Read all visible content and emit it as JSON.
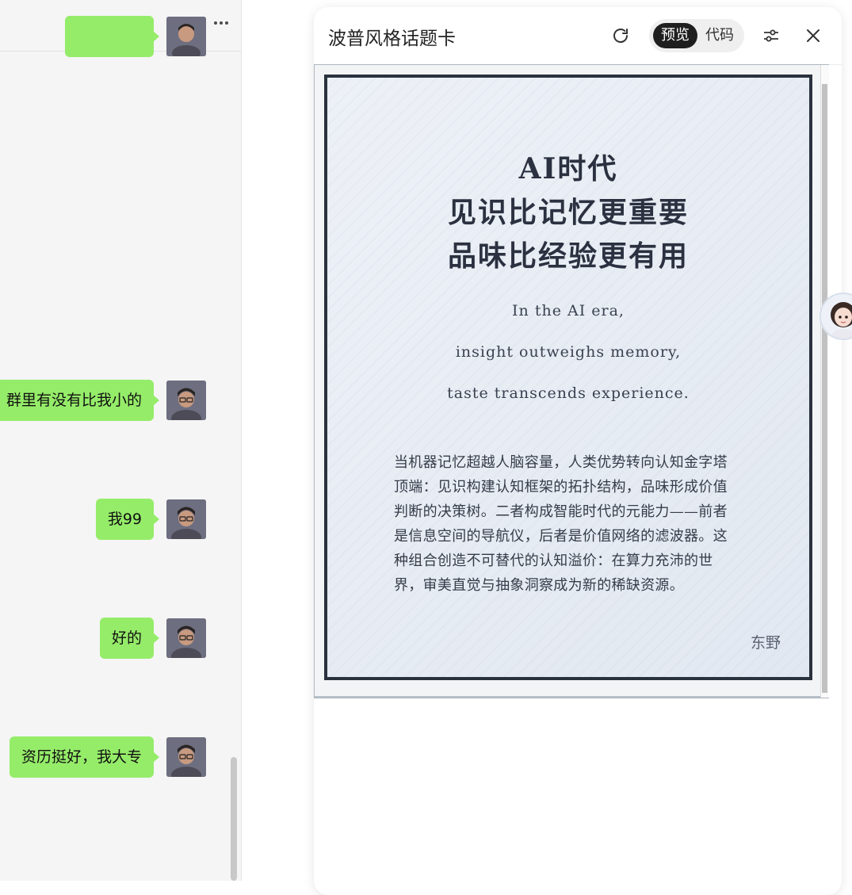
{
  "chat": {
    "more_label": "···",
    "messages": [
      {
        "text": ""
      },
      {
        "text": "群里有没有比我小的"
      },
      {
        "text": "我99"
      },
      {
        "text": "好的"
      },
      {
        "text": "资历挺好，我大专"
      }
    ]
  },
  "panel": {
    "title": "波普风格话题卡",
    "toggle": {
      "preview": "预览",
      "code": "代码"
    },
    "icons": [
      "refresh-icon",
      "settings-sliders-icon",
      "close-icon"
    ]
  },
  "card": {
    "title_lines": [
      "AI时代",
      "见识比记忆更重要",
      "品味比经验更有用"
    ],
    "english_lines": [
      "In the AI era,",
      "insight outweighs memory,",
      "taste transcends experience."
    ],
    "body_lines": [
      "当机器记忆超越人脑容量，人类优势转向认知金字塔",
      "顶端：见识构建认知框架的拓扑结构，品味形成价值",
      "判断的决策树。二者构成智能时代的元能力——前者",
      "是信息空间的导航仪，后者是价值网络的滤波器。这",
      "种组合创造不可替代的认知溢价：在算力充沛的世",
      "界，审美直觉与抽象洞察成为新的稀缺资源。"
    ],
    "signature": "东野"
  },
  "colors": {
    "bubble": "#95ec69",
    "card_border": "#2a323e",
    "card_bg": "#e8edf4"
  }
}
